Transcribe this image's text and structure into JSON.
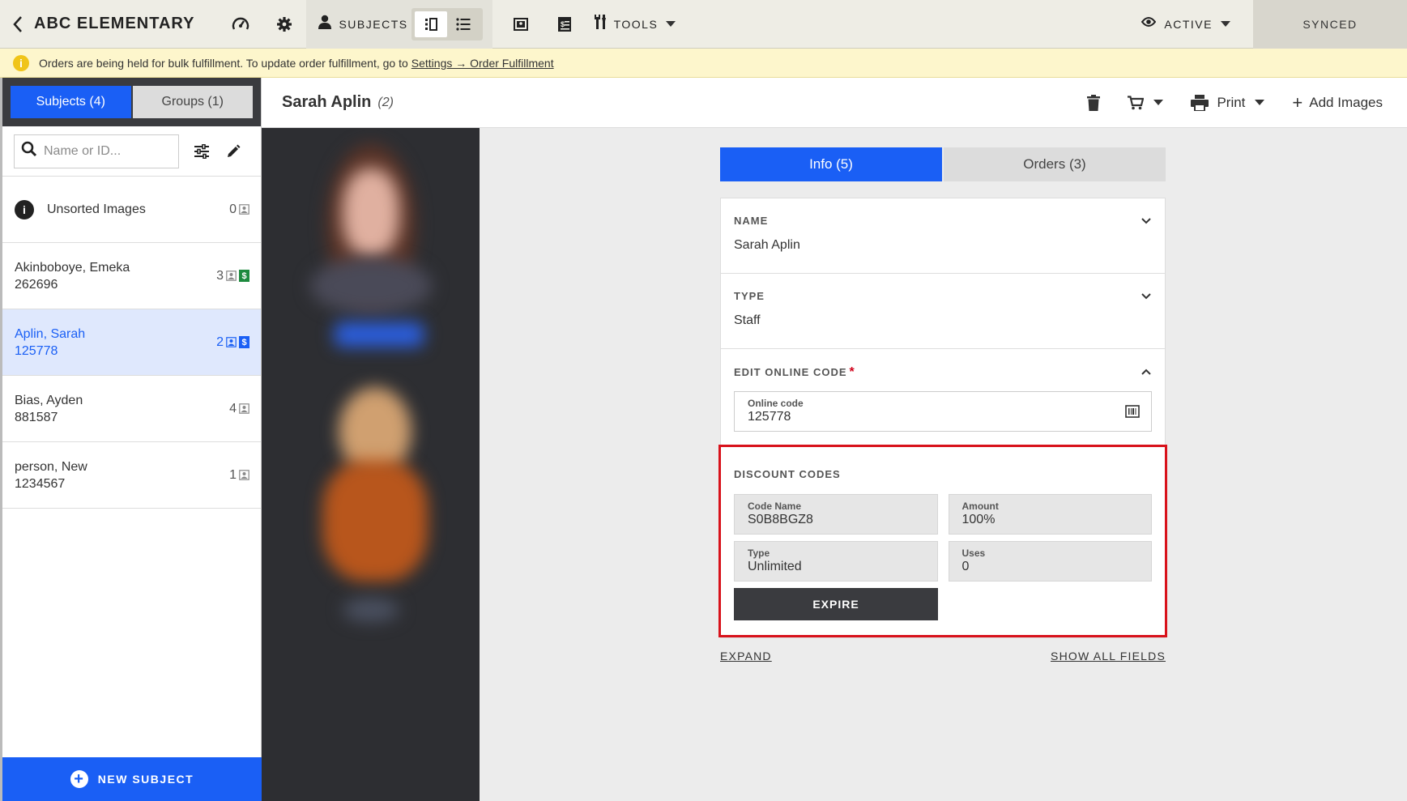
{
  "topbar": {
    "title": "ABC ELEMENTARY",
    "subjects_label": "SUBJECTS",
    "tools_label": "TOOLS",
    "active_label": "ACTIVE",
    "synced_label": "SYNCED"
  },
  "banner": {
    "text": "Orders are being held for bulk fulfillment. To update order fulfillment, go to",
    "link": "Settings → Order Fulfillment"
  },
  "sidebar": {
    "tabs": [
      {
        "label": "Subjects (4)",
        "active": true
      },
      {
        "label": "Groups (1)",
        "active": false
      }
    ],
    "search_placeholder": "Name or ID...",
    "unsorted": {
      "label": "Unsorted Images",
      "count": "0"
    },
    "items": [
      {
        "name": "Akinboboye, Emeka",
        "id": "262696",
        "count": "3",
        "paid": true
      },
      {
        "name": "Aplin, Sarah",
        "id": "125778",
        "count": "2",
        "paid": true,
        "selected": true
      },
      {
        "name": "Bias, Ayden",
        "id": "881587",
        "count": "4",
        "paid": false
      },
      {
        "name": "person, New",
        "id": "1234567",
        "count": "1",
        "paid": false
      }
    ],
    "new_subject_label": "NEW SUBJECT"
  },
  "header": {
    "name": "Sarah Aplin",
    "count": "(2)",
    "print_label": "Print",
    "add_images_label": "Add Images"
  },
  "detail": {
    "tabs": [
      {
        "label": "Info (5)",
        "active": true
      },
      {
        "label": "Orders (3)",
        "active": false
      }
    ],
    "name_label": "NAME",
    "name_value": "Sarah Aplin",
    "type_label": "TYPE",
    "type_value": "Staff",
    "online_code_section": "EDIT ONLINE CODE",
    "required_mark": "*",
    "online_code_label": "Online code",
    "online_code_value": "125778",
    "discount": {
      "section": "DISCOUNT CODES",
      "code_name_label": "Code Name",
      "code_name_value": "S0B8BGZ8",
      "amount_label": "Amount",
      "amount_value": "100%",
      "type_label": "Type",
      "type_value": "Unlimited",
      "uses_label": "Uses",
      "uses_value": "0",
      "expire_label": "EXPIRE"
    },
    "expand_label": "EXPAND",
    "show_all_label": "SHOW ALL FIELDS"
  },
  "colors": {
    "accent": "#1a5ff5",
    "highlight_border": "#d8121b",
    "paid_badge": "#1d8a3e"
  }
}
